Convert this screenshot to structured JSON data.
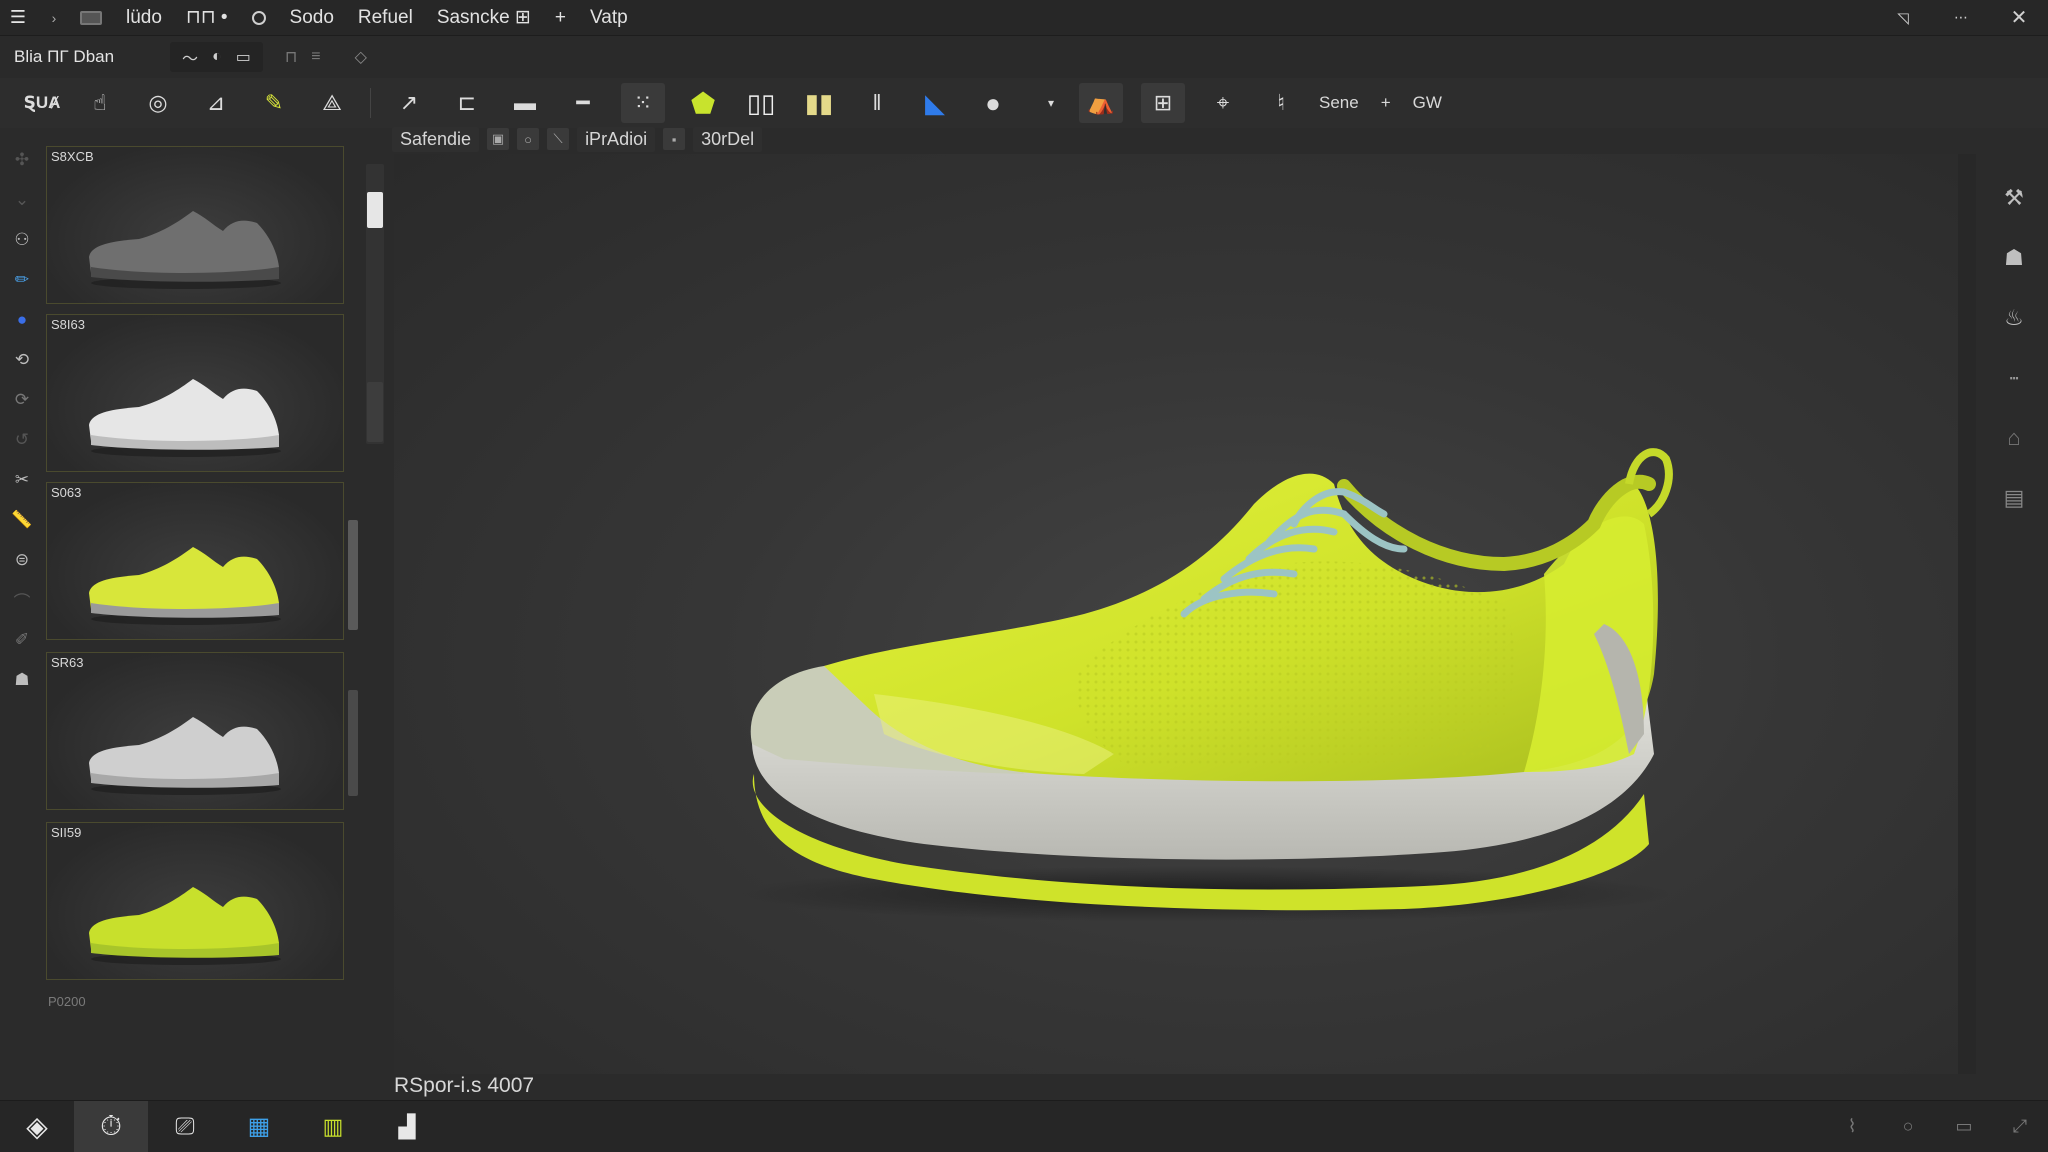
{
  "menubar": {
    "items": [
      "lüdo",
      "Sodo",
      "Refuel",
      "Sasncke ⊞",
      "+",
      "Vatp"
    ],
    "glyph_after_ludo": "⊓⊓ •"
  },
  "subbar": {
    "title": "Blia  ΠΓ Dban"
  },
  "toolbar": {
    "tool_label": "ⱾUȺ",
    "labels": [
      "Sene",
      "+",
      "GW"
    ]
  },
  "thumbnails": [
    {
      "label": "S8XCB",
      "color": "#6f6f6f",
      "sole": "#4a4a4a"
    },
    {
      "label": "S8I63",
      "color": "#e6e6e6",
      "sole": "#bdbdbd"
    },
    {
      "label": "S063",
      "color": "#d8e63a",
      "sole": "#9a9a9a"
    },
    {
      "label": "SR63",
      "color": "#cfcfcf",
      "sole": "#a8a8a8"
    },
    {
      "label": "SII59",
      "color": "#c8e02c",
      "sole": "#a8c52a"
    }
  ],
  "thumbs_footer": "P0200",
  "viewport": {
    "tabs": [
      "Safendie",
      "iPrAdioi",
      "30rDel"
    ],
    "status": "RSpor-i.s 4007"
  },
  "colors": {
    "accent_yellow": "#d6ee2f",
    "upper_yellow": "#cfe32a",
    "midsole": "#d9d9d3",
    "laces": "#9cc4c4"
  },
  "icons": {
    "menu": "hamburger-icon",
    "close": "close-icon",
    "minimize": "minimize-icon"
  }
}
